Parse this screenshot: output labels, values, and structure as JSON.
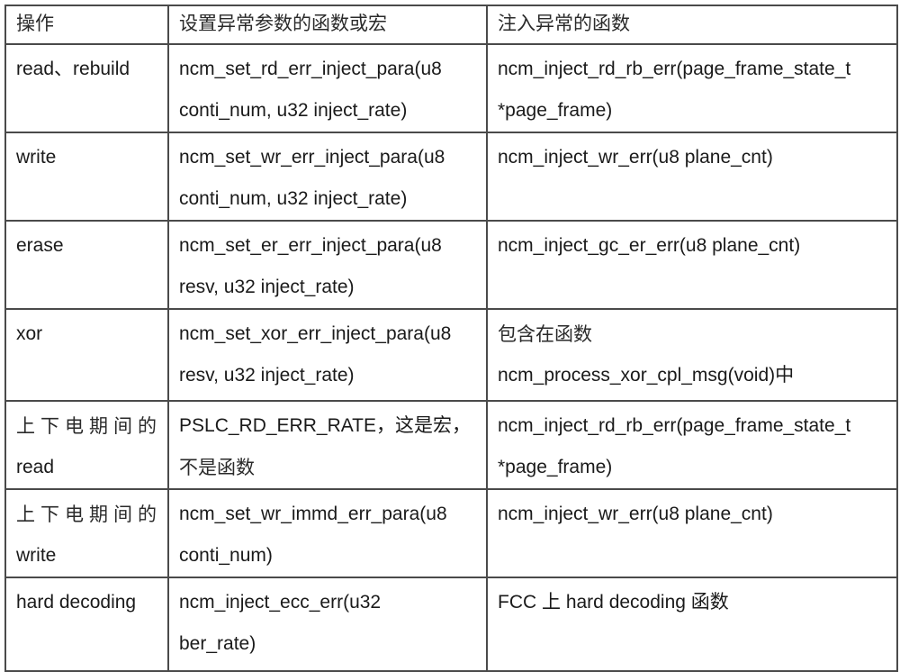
{
  "table": {
    "headers": [
      "操作",
      "设置异常参数的函数或宏",
      "注入异常的函数"
    ],
    "rows": [
      {
        "operation": [
          "read、rebuild"
        ],
        "set_param": [
          "ncm_set_rd_err_inject_para(u8",
          "conti_num, u32 inject_rate)"
        ],
        "inject": [
          "ncm_inject_rd_rb_err(page_frame_state_t",
          "*page_frame)"
        ]
      },
      {
        "operation": [
          "write"
        ],
        "set_param": [
          "ncm_set_wr_err_inject_para(u8",
          "conti_num, u32 inject_rate)"
        ],
        "inject": [
          "ncm_inject_wr_err(u8 plane_cnt)"
        ]
      },
      {
        "operation": [
          "erase"
        ],
        "set_param": [
          "ncm_set_er_err_inject_para(u8",
          "resv, u32 inject_rate)"
        ],
        "inject": [
          "ncm_inject_gc_er_err(u8 plane_cnt)"
        ]
      },
      {
        "operation": [
          "xor"
        ],
        "set_param": [
          "ncm_set_xor_err_inject_para(u8",
          "resv, u32 inject_rate)"
        ],
        "inject": [
          "包含在函数",
          "ncm_process_xor_cpl_msg(void)中"
        ]
      },
      {
        "operation": [
          "上下电期间的",
          "read"
        ],
        "set_param": [
          "PSLC_RD_ERR_RATE，这是宏，",
          "不是函数"
        ],
        "inject": [
          "ncm_inject_rd_rb_err(page_frame_state_t",
          "*page_frame)"
        ]
      },
      {
        "operation": [
          "上下电期间的",
          "write"
        ],
        "set_param": [
          "ncm_set_wr_immd_err_para(u8",
          "conti_num)"
        ],
        "inject": [
          "ncm_inject_wr_err(u8 plane_cnt)"
        ]
      },
      {
        "operation": [
          "hard decoding"
        ],
        "set_param": [
          "ncm_inject_ecc_err(u32",
          "ber_rate)"
        ],
        "inject": [
          "FCC 上 hard decoding 函数"
        ]
      }
    ]
  }
}
